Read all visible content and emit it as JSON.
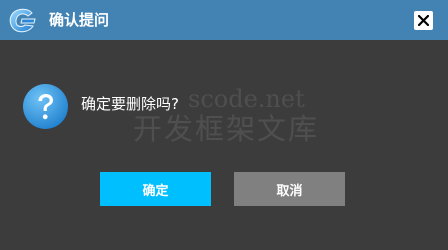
{
  "dialog": {
    "title": "确认提问",
    "message": "确定要删除吗?",
    "watermark": {
      "line1": "scode.net",
      "line2": "开发框架文库"
    },
    "buttons": {
      "confirm": "确定",
      "cancel": "取消"
    }
  },
  "icons": {
    "logo": "app-logo-icon",
    "close": "close-icon",
    "question": "question-icon"
  },
  "colors": {
    "titlebar": "#4383b4",
    "body": "#3c3c3c",
    "confirm_button": "#00bfff",
    "cancel_button": "#808080",
    "question_icon": "#3596d9"
  }
}
